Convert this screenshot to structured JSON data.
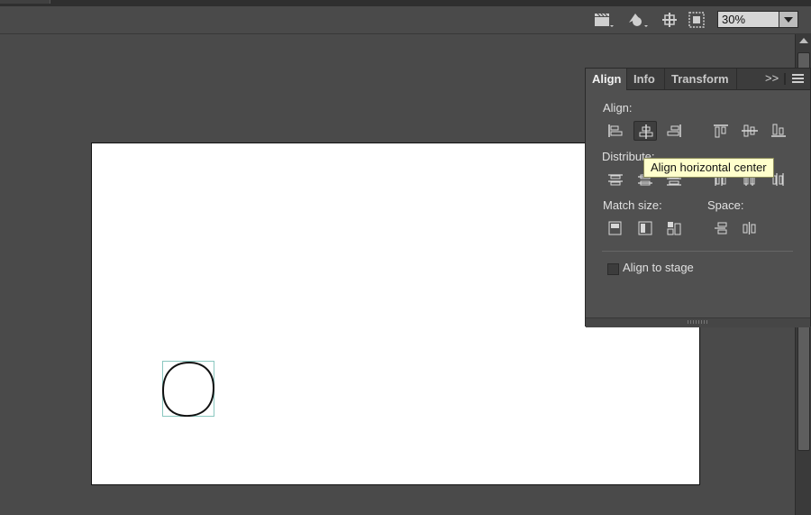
{
  "toolbar": {
    "icons": [
      "edit-scene-icon",
      "edit-symbols-icon",
      "snap-to-object-icon",
      "clip-content-icon"
    ],
    "zoom_value": "30%"
  },
  "align_panel": {
    "tabs": [
      {
        "label": "Align",
        "active": true
      },
      {
        "label": "Info",
        "active": false
      },
      {
        "label": "Transform",
        "active": false
      }
    ],
    "collapse_glyph": ">>",
    "align_label": "Align:",
    "distribute_label": "Distribute:",
    "match_size_label": "Match size:",
    "space_label": "Space:",
    "align_to_stage_label": "Align to stage",
    "align_to_stage_checked": false,
    "align_buttons": [
      "align-left-edge",
      "align-horizontal-center",
      "align-right-edge",
      "align-top-edge",
      "align-vertical-center",
      "align-bottom-edge"
    ],
    "distribute_buttons": [
      "distribute-top-edge",
      "distribute-vertical-center",
      "distribute-bottom-edge",
      "distribute-left-edge",
      "distribute-horizontal-center",
      "distribute-right-edge"
    ],
    "match_size_buttons": [
      "match-width",
      "match-height",
      "match-width-and-height"
    ],
    "space_buttons": [
      "space-evenly-vertically",
      "space-evenly-horizontally"
    ],
    "selected_button": "align-horizontal-center"
  },
  "tooltip": {
    "text": "Align horizontal center"
  },
  "colors": {
    "workspace": "#4a4a4a",
    "stage": "#ffffff",
    "panel": "#505050",
    "tooltip_bg": "#ffffcc",
    "selection_box": "#8ac7c0"
  }
}
